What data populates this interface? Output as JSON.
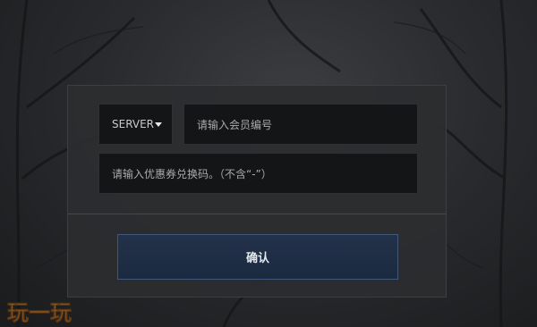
{
  "form": {
    "server_label": "SERVER",
    "member_placeholder": "请输入会员编号",
    "coupon_placeholder": "请输入优惠券兑换码。（不含“-”）",
    "confirm_label": "确认"
  },
  "watermark": {
    "text": "玩一玩",
    "colors": [
      "#e8a33d",
      "#d9712a"
    ]
  },
  "theme": {
    "panel_bg": "#2c2d2f",
    "input_bg": "#141516",
    "button_bg": "#1f2e45",
    "button_border": "#40587a"
  }
}
